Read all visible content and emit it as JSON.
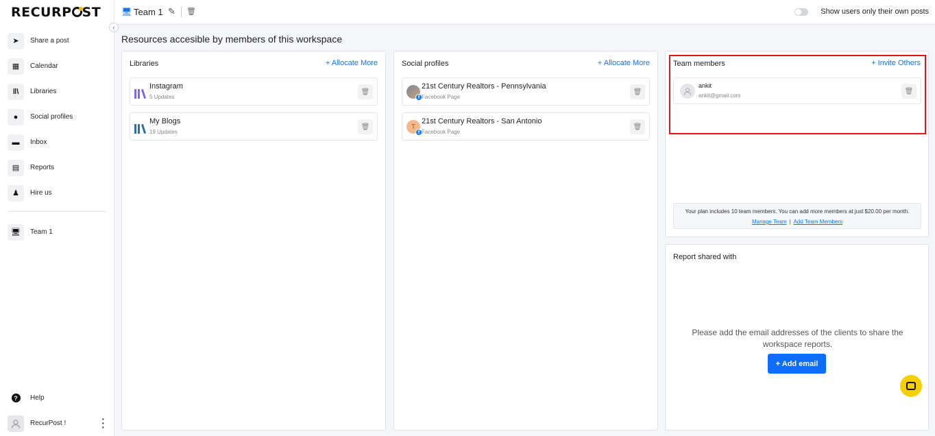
{
  "brand": {
    "name_left": "RECURP",
    "name_right": "ST"
  },
  "sidebar": {
    "items": [
      {
        "icon": "send-icon",
        "glyph": "➤",
        "label": "Share a post"
      },
      {
        "icon": "calendar-icon",
        "glyph": "▦",
        "label": "Calendar"
      },
      {
        "icon": "library-icon",
        "glyph": "‖\\",
        "label": "Libraries"
      },
      {
        "icon": "social-profiles-icon",
        "glyph": "●",
        "label": "Social profiles"
      },
      {
        "icon": "inbox-icon",
        "glyph": "▬",
        "label": "Inbox"
      },
      {
        "icon": "reports-icon",
        "glyph": "▤",
        "label": "Reports"
      },
      {
        "icon": "hire-us-icon",
        "glyph": "♟",
        "label": "Hire us"
      }
    ],
    "team": {
      "icon": "workspace-icon",
      "label": "Team 1"
    },
    "help": {
      "icon": "help-icon",
      "label": "Help"
    },
    "user": {
      "label": "RecurPost !"
    }
  },
  "topbar": {
    "team_name": "Team 1",
    "toggle_label": "Show users only their own posts",
    "toggle_on": false
  },
  "main": {
    "title": "Resources accesible by members of this workspace",
    "libraries": {
      "heading": "Libraries",
      "action": "+ Allocate More",
      "items": [
        {
          "title": "Instagram",
          "sub": "5 Updates",
          "color": "#7b68ee"
        },
        {
          "title": "My Blogs",
          "sub": "19 Updates",
          "color": "#2f6f9f"
        }
      ]
    },
    "social_profiles": {
      "heading": "Social profiles",
      "action": "+ Allocate More",
      "items": [
        {
          "title": "21st Century Realtors - Pennsylvania",
          "sub": "Facebook Page"
        },
        {
          "title": "21st Century Realtors - San Antonio",
          "sub": "Facebook Page",
          "initial": "T"
        }
      ]
    },
    "team_members": {
      "heading": "Team members",
      "action": "+ Invite Others",
      "members": [
        {
          "name": "ankit",
          "email": "ankit@gmail.com"
        }
      ],
      "plan_note": "Your plan includes 10 team members. You can add more members at just $20.00 per month.",
      "manage_link": "Manage Team",
      "add_link": "Add Team Members"
    },
    "report_shared": {
      "heading": "Report shared with",
      "message": "Please add the email addresses of the clients to share the workspace reports.",
      "button": "+ Add email"
    }
  },
  "colors": {
    "accent": "#1a73e8",
    "button": "#0d6efd",
    "highlight": "#e0121a",
    "chat": "#f5d000"
  }
}
